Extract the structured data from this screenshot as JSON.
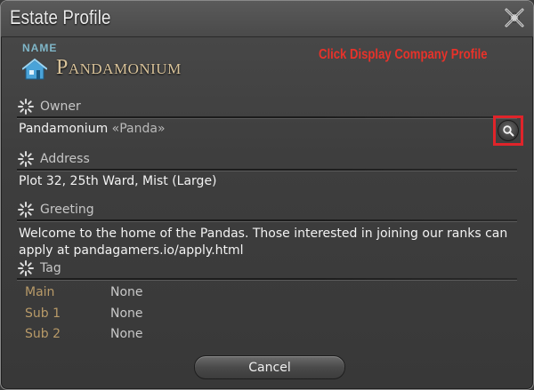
{
  "window": {
    "title": "Estate Profile",
    "close_icon": "crossed-swords-close-icon"
  },
  "estate": {
    "name_label": "NAME",
    "name": "Pandamonium",
    "icon": "house-icon"
  },
  "annotation": {
    "text": "Click Display Company Profile",
    "color": "#e8322a"
  },
  "owner": {
    "heading": "Owner",
    "name": "Pandamonium",
    "tag": "«Panda»",
    "profile_button_icon": "search-icon"
  },
  "address": {
    "heading": "Address",
    "value": "Plot 32, 25th Ward, Mist (Large)"
  },
  "greeting": {
    "heading": "Greeting",
    "text": "Welcome to the home of the Pandas. Those interested in joining our ranks can apply at pandagamers.io/apply.html"
  },
  "tag": {
    "heading": "Tag",
    "rows": [
      {
        "key": "Main",
        "value": "None"
      },
      {
        "key": "Sub 1",
        "value": "None"
      },
      {
        "key": "Sub 2",
        "value": "None"
      }
    ]
  },
  "buttons": {
    "cancel_label": "Cancel"
  },
  "colors": {
    "highlight": "#e0242a",
    "estate_name": "#d9c39a",
    "name_label": "#7fb6c8",
    "tag_key": "#b89a68"
  }
}
